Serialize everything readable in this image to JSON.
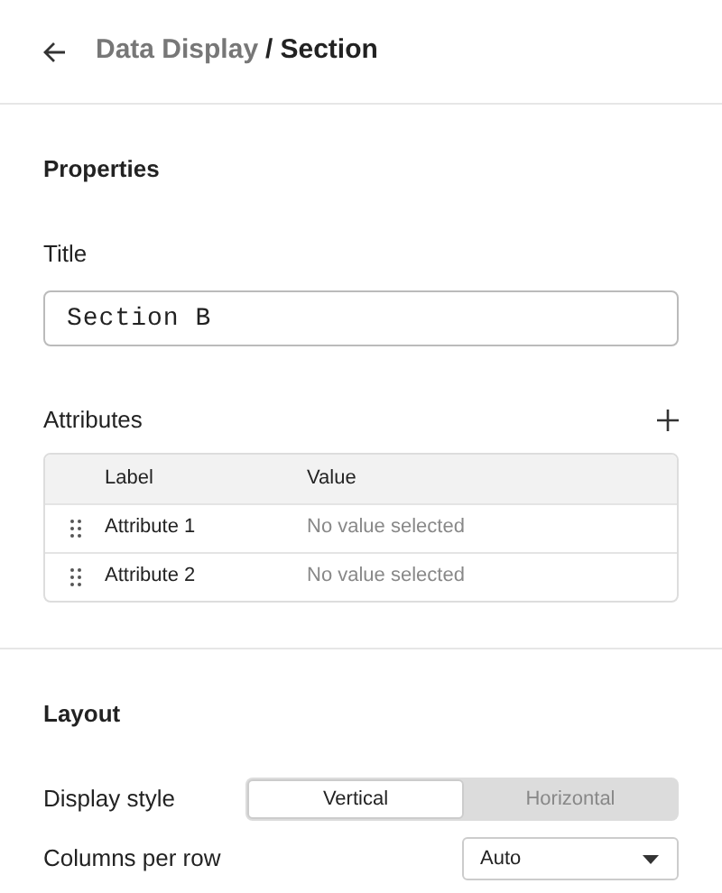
{
  "header": {
    "breadcrumb": [
      {
        "label": "Data Display",
        "current": false
      },
      {
        "label": "Section",
        "current": true
      }
    ],
    "separator": "/"
  },
  "properties": {
    "heading": "Properties",
    "title_label": "Title",
    "title_value": "Section B",
    "attributes": {
      "label": "Attributes",
      "columns": [
        "Label",
        "Value"
      ],
      "rows": [
        {
          "label": "Attribute 1",
          "value": "No value selected"
        },
        {
          "label": "Attribute 2",
          "value": "No value selected"
        }
      ]
    }
  },
  "layout": {
    "heading": "Layout",
    "display_style": {
      "label": "Display style",
      "options": [
        {
          "label": "Vertical",
          "selected": true
        },
        {
          "label": "Horizontal",
          "selected": false
        }
      ]
    },
    "columns_per_row": {
      "label": "Columns per row",
      "value": "Auto"
    }
  }
}
